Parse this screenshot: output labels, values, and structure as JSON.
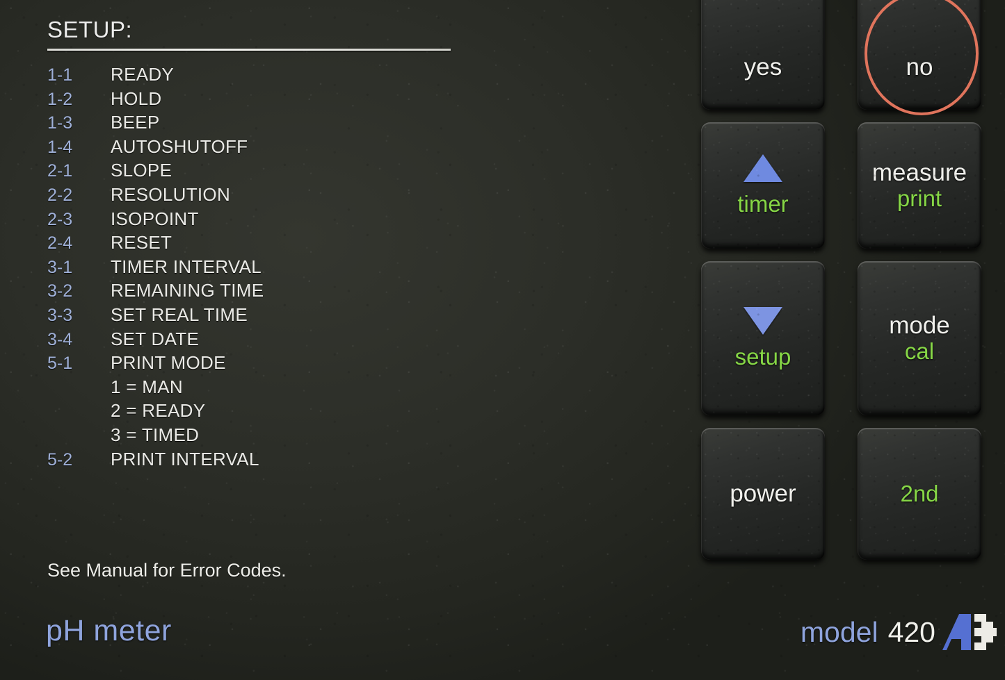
{
  "device": {
    "type": "pH meter",
    "model_label": "model",
    "model_number": "420",
    "logo_name": "orion-a-logo"
  },
  "setup_panel": {
    "heading": "SETUP:",
    "entries": [
      {
        "code": "1-1",
        "label": "READY",
        "sub": false
      },
      {
        "code": "1-2",
        "label": "HOLD",
        "sub": false
      },
      {
        "code": "1-3",
        "label": "BEEP",
        "sub": false
      },
      {
        "code": "1-4",
        "label": "AUTOSHUTOFF",
        "sub": false
      },
      {
        "code": "2-1",
        "label": "SLOPE",
        "sub": false
      },
      {
        "code": "2-2",
        "label": "RESOLUTION",
        "sub": false
      },
      {
        "code": "2-3",
        "label": "ISOPOINT",
        "sub": false
      },
      {
        "code": "2-4",
        "label": "RESET",
        "sub": false
      },
      {
        "code": "3-1",
        "label": "TIMER INTERVAL",
        "sub": false
      },
      {
        "code": "3-2",
        "label": "REMAINING TIME",
        "sub": false
      },
      {
        "code": "3-3",
        "label": "SET REAL TIME",
        "sub": false
      },
      {
        "code": "3-4",
        "label": "SET DATE",
        "sub": false
      },
      {
        "code": "5-1",
        "label": "PRINT MODE",
        "sub": false
      },
      {
        "code": "",
        "label": "1 = MAN",
        "sub": true
      },
      {
        "code": "",
        "label": "2 = READY",
        "sub": true
      },
      {
        "code": "",
        "label": "3 = TIMED",
        "sub": true
      },
      {
        "code": "5-2",
        "label": "PRINT INTERVAL",
        "sub": false
      }
    ],
    "footnote": "See Manual for Error Codes."
  },
  "keypad": {
    "keys": [
      {
        "name": "yes",
        "glyph": "",
        "primary": "yes",
        "secondary": ""
      },
      {
        "name": "no",
        "glyph": "",
        "primary": "no",
        "secondary": ""
      },
      {
        "name": "timer",
        "glyph": "up",
        "primary": "",
        "secondary": "timer"
      },
      {
        "name": "measure",
        "glyph": "",
        "primary": "measure",
        "secondary": "print"
      },
      {
        "name": "setup",
        "glyph": "down",
        "primary": "",
        "secondary": "setup"
      },
      {
        "name": "mode",
        "glyph": "",
        "primary": "mode",
        "secondary": "cal"
      },
      {
        "name": "power",
        "glyph": "",
        "primary": "power",
        "secondary": ""
      },
      {
        "name": "2nd",
        "glyph": "",
        "primary": "",
        "secondary": "2nd"
      }
    ]
  },
  "annotation": {
    "name": "highlight-circle-around-no-key",
    "color": "#e0745c",
    "target": "no"
  },
  "colors": {
    "panel_background": "#2c2e28",
    "code_blue": "#9fb0d8",
    "label_white": "#eaeae6",
    "secondary_green": "#86d646",
    "arrow_blue": "#7d94e2",
    "brand_blue": "#8fa4dd",
    "annotation_coral": "#e0745c"
  }
}
